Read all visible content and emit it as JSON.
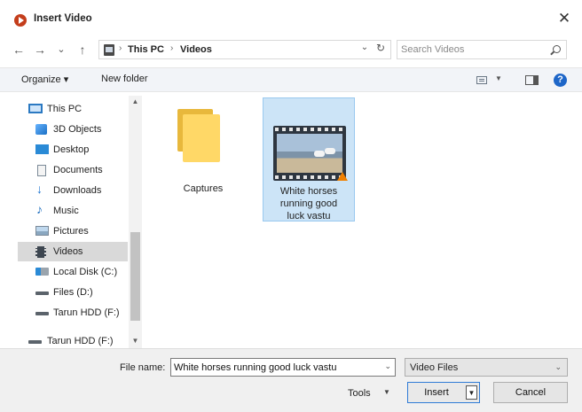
{
  "window": {
    "title": "Insert Video",
    "close_glyph": "✕",
    "accent_color": "#c43e1c"
  },
  "navigation": {
    "back_glyph": "←",
    "forward_glyph": "→",
    "recent_glyph": "⌄",
    "up_glyph": "↑"
  },
  "address": {
    "crumbs": [
      "This PC",
      "Videos"
    ],
    "separator": "›",
    "dropdown_glyph": "⌄",
    "refresh_glyph": "↻"
  },
  "search": {
    "placeholder": "Search Videos",
    "icon": "search-icon"
  },
  "toolbar": {
    "organize_label": "Organize ▾",
    "new_folder_label": "New folder",
    "view_caret": "▼",
    "help_label": "?"
  },
  "sidebar": {
    "items": [
      {
        "label": "This PC",
        "icon": "pc-icon"
      },
      {
        "label": "3D Objects",
        "icon": "3d-objects-icon"
      },
      {
        "label": "Desktop",
        "icon": "desktop-icon"
      },
      {
        "label": "Documents",
        "icon": "documents-icon"
      },
      {
        "label": "Downloads",
        "icon": "download-arrow-icon"
      },
      {
        "label": "Music",
        "icon": "music-note-icon"
      },
      {
        "label": "Pictures",
        "icon": "pictures-icon"
      },
      {
        "label": "Videos",
        "icon": "film-strip-icon",
        "selected": true
      },
      {
        "label": "Local Disk (C:)",
        "icon": "windows-drive-icon"
      },
      {
        "label": "Files  (D:)",
        "icon": "drive-icon"
      },
      {
        "label": "Tarun HDD (F:)",
        "icon": "drive-icon"
      },
      {
        "label": "Tarun HDD (F:)",
        "icon": "drive-icon"
      }
    ],
    "scroll_up_glyph": "▲",
    "scroll_down_glyph": "▼"
  },
  "files": [
    {
      "name": "Captures",
      "type": "folder"
    },
    {
      "name_lines": [
        "White horses",
        "running good",
        "luck vastu"
      ],
      "type": "video",
      "selected": true
    }
  ],
  "footer": {
    "file_name_label": "File name:",
    "file_name_value": "White horses running good luck vastu",
    "file_name_caret": "⌄",
    "file_type_value": "Video Files",
    "file_type_caret": "⌄",
    "tools_label": "Tools",
    "tools_caret": "▼",
    "insert_label": "Insert",
    "insert_split_glyph": "▼",
    "cancel_label": "Cancel"
  }
}
